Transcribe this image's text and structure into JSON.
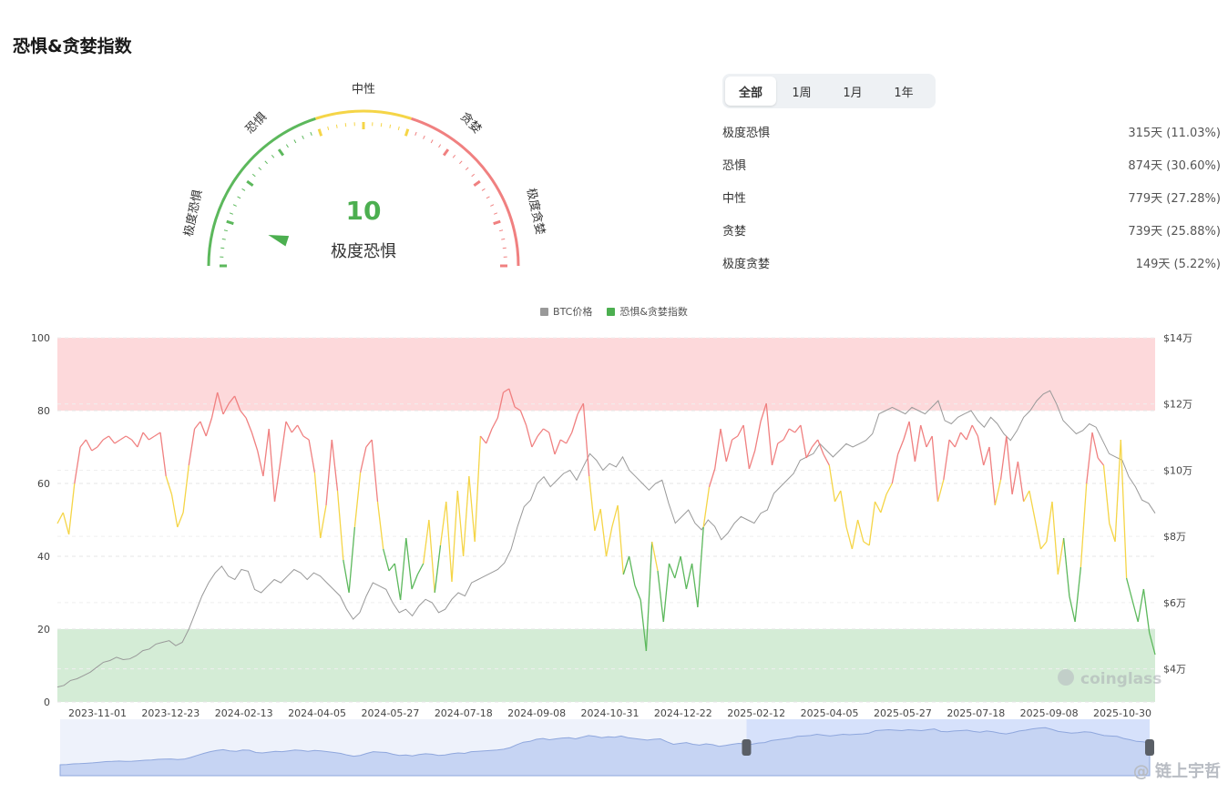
{
  "title": "恐惧&贪婪指数",
  "gauge": {
    "value": "10",
    "value_num": 10,
    "state_label": "极度恐惧",
    "zone_labels": {
      "extreme_fear": "极度恐惧",
      "fear": "恐惧",
      "neutral": "中性",
      "greed": "贪婪",
      "extreme_greed": "极度贪婪"
    },
    "colors": {
      "fear": "#5cb85c",
      "neutral": "#f5d547",
      "greed": "#f08080"
    }
  },
  "range_tabs": {
    "items": [
      "全部",
      "1周",
      "1月",
      "1年"
    ],
    "active": "全部"
  },
  "stats": [
    {
      "label": "极度恐惧",
      "value": "315天 (11.03%)"
    },
    {
      "label": "恐惧",
      "value": "874天 (30.60%)"
    },
    {
      "label": "中性",
      "value": "779天 (27.28%)"
    },
    {
      "label": "贪婪",
      "value": "739天 (25.88%)"
    },
    {
      "label": "极度贪婪",
      "value": "149天 (5.22%)"
    }
  ],
  "legend": {
    "btc_label": "BTC价格",
    "index_label": "恐惧&贪婪指数",
    "btc_color": "#999999",
    "index_color": "#4caf50"
  },
  "watermark": "coinglass",
  "corner_watermark": "@ 链上宇哲",
  "chart_data": {
    "type": "line",
    "x_tick_labels": [
      "2023-11-01",
      "2023-12-23",
      "2024-02-13",
      "2024-04-05",
      "2024-05-27",
      "2024-07-18",
      "2024-09-08",
      "2024-10-31",
      "2024-12-22",
      "2025-02-12",
      "2025-04-05",
      "2025-05-27",
      "2025-07-18",
      "2025-09-08",
      "2025-10-30"
    ],
    "y_left": {
      "ticks": [
        "0",
        "20",
        "40",
        "60",
        "80",
        "100"
      ],
      "range": [
        0,
        100
      ]
    },
    "y_right": {
      "ticks": [
        "$4万",
        "$6万",
        "$8万",
        "$10万",
        "$12万",
        "$14万"
      ],
      "range": [
        30000,
        140000
      ],
      "tick_values": [
        40000,
        60000,
        80000,
        100000,
        120000,
        140000
      ]
    },
    "bands": [
      {
        "from": 80,
        "to": 100,
        "color": "#fdd9db"
      },
      {
        "from": 0,
        "to": 20,
        "color": "#d4ecd6"
      }
    ],
    "thresholds": {
      "fear": 40,
      "greed": 60
    },
    "series": [
      {
        "name": "恐惧&贪婪指数",
        "axis": "left",
        "values": [
          49,
          52,
          46,
          60,
          70,
          72,
          69,
          70,
          72,
          73,
          71,
          72,
          73,
          72,
          70,
          74,
          72,
          73,
          74,
          62,
          57,
          48,
          52,
          65,
          75,
          77,
          73,
          78,
          85,
          79,
          82,
          84,
          80,
          78,
          74,
          69,
          62,
          75,
          55,
          66,
          77,
          74,
          76,
          73,
          72,
          63,
          45,
          54,
          72,
          58,
          39,
          30,
          48,
          63,
          70,
          72,
          55,
          42,
          36,
          38,
          28,
          45,
          31,
          35,
          38,
          50,
          30,
          43,
          55,
          33,
          58,
          40,
          62,
          44,
          73,
          71,
          75,
          78,
          85,
          86,
          81,
          80,
          76,
          70,
          73,
          75,
          74,
          68,
          72,
          71,
          74,
          79,
          82,
          62,
          47,
          53,
          40,
          48,
          54,
          35,
          40,
          32,
          28,
          14,
          44,
          36,
          22,
          38,
          34,
          40,
          31,
          38,
          26,
          48,
          59,
          64,
          75,
          66,
          72,
          73,
          76,
          64,
          69,
          77,
          82,
          65,
          71,
          72,
          75,
          74,
          76,
          67,
          70,
          72,
          68,
          65,
          55,
          58,
          48,
          42,
          50,
          44,
          43,
          55,
          52,
          57,
          60,
          68,
          72,
          77,
          66,
          76,
          70,
          73,
          55,
          61,
          72,
          70,
          74,
          72,
          76,
          73,
          65,
          70,
          54,
          61,
          73,
          57,
          66,
          55,
          58,
          50,
          42,
          44,
          55,
          35,
          45,
          29,
          22,
          37,
          60,
          74,
          67,
          65,
          49,
          44,
          72,
          34,
          28,
          22,
          31,
          19,
          13
        ],
        "color_by_zone": {
          "fear": "#5cb85c",
          "neutral": "#f5d547",
          "greed": "#f08080"
        }
      },
      {
        "name": "BTC价格",
        "axis": "right",
        "color": "#999999",
        "values": [
          34500,
          35000,
          36500,
          37000,
          38000,
          39000,
          40500,
          42000,
          42500,
          43500,
          42800,
          43000,
          44000,
          45500,
          46000,
          47500,
          48000,
          48500,
          47000,
          48000,
          52000,
          57000,
          62000,
          66000,
          69000,
          71000,
          68000,
          67000,
          70000,
          69500,
          64000,
          63000,
          65000,
          67000,
          66000,
          68000,
          70000,
          69000,
          67000,
          69000,
          68000,
          66000,
          64000,
          62000,
          58000,
          55000,
          57000,
          62000,
          66000,
          65000,
          64000,
          60000,
          57000,
          58000,
          56000,
          59000,
          61000,
          60000,
          57000,
          58000,
          61000,
          63000,
          62000,
          66000,
          67000,
          68000,
          69000,
          70000,
          72000,
          76000,
          83000,
          89000,
          91000,
          96000,
          98000,
          95000,
          97000,
          99000,
          100000,
          97000,
          101000,
          105000,
          103000,
          100000,
          102000,
          101000,
          104000,
          100000,
          98000,
          96000,
          94000,
          96000,
          97000,
          90000,
          84000,
          86000,
          88000,
          84000,
          82000,
          85000,
          83000,
          79000,
          81000,
          84000,
          86000,
          85000,
          84000,
          87000,
          88000,
          93000,
          95000,
          97000,
          99000,
          103000,
          104000,
          105000,
          108000,
          106000,
          104000,
          106000,
          108000,
          107000,
          108000,
          109000,
          111000,
          117000,
          118000,
          119000,
          118000,
          117000,
          119000,
          118000,
          117000,
          119000,
          121000,
          115000,
          114000,
          116000,
          117000,
          118000,
          115000,
          113000,
          116000,
          114000,
          111000,
          109000,
          112000,
          116000,
          118000,
          121000,
          123000,
          124000,
          120000,
          115000,
          113000,
          111000,
          112000,
          114000,
          113000,
          109000,
          105000,
          104000,
          103000,
          98000,
          95000,
          91000,
          90000,
          87000
        ]
      }
    ],
    "navigator": {
      "range_start_fraction": 0.63,
      "range_end_fraction": 1.0
    }
  }
}
